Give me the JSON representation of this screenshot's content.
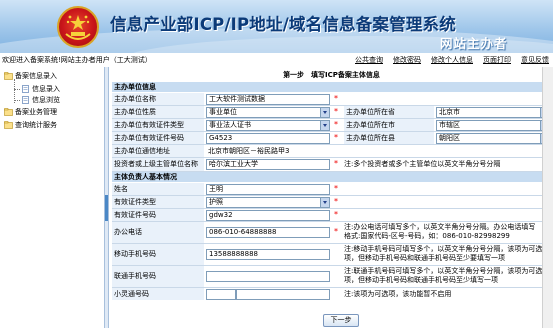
{
  "header": {
    "title": "信息产业部ICP/IP地址/域名信息备案管理系统",
    "subtitle": "网站主办者"
  },
  "userbar": {
    "welcome": "欢迎进入备案系统!网站主办者用户（工大测试）",
    "links": [
      "公共查询",
      "修改密码",
      "修改个人信息",
      "页面打印",
      "意见反馈"
    ]
  },
  "sidebar": {
    "items": [
      {
        "label": "备案信息录入",
        "children": [
          "信息录入",
          "信息浏览"
        ]
      },
      {
        "label": "备案业务管理",
        "children": []
      },
      {
        "label": "查询统计服务",
        "children": []
      }
    ]
  },
  "form": {
    "step_title": "第一步　填写ICP备案主体信息",
    "section1": "主办单位信息",
    "section2": "主体负责人基本情况",
    "org_name_label": "主办单位名称",
    "org_name_value": "工大软件测试数据",
    "org_type_label": "主办单位性质",
    "org_type_value": "事业单位",
    "province_label": "主办单位所在省",
    "province_value": "北京市",
    "cert_type_label": "主办单位有效证件类型",
    "cert_type_value": "事业法人证书",
    "city_label": "主办单位所在市",
    "city_value": "市辖区",
    "cert_no_label": "主办单位有效证件号码",
    "cert_no_value": "G4523",
    "county_label": "主办单位所在县",
    "county_value": "朝阳区",
    "address_label": "主办单位通信地址",
    "address_value": "北京市朝阳区－裕民路甲3",
    "investor_label": "投资者或上级主管单位名称",
    "investor_value": "哈尔滨工业大学",
    "investor_note": "注:多个投资者或多个主管单位以英文半角分号分隔",
    "name_label": "姓名",
    "name_value": "王明",
    "p_cert_type_label": "有效证件类型",
    "p_cert_type_value": "护照",
    "p_cert_no_label": "有效证件号码",
    "p_cert_no_value": "gdw32",
    "office_phone_label": "办公电话",
    "office_phone_value": "086-010-64888888",
    "office_phone_note1": "注:办公电话可填写多个，以英文半角分号分隔。办公电话填写",
    "office_phone_note2": "格式:国家代码-区号-号码，如：086-010-82998299",
    "mobile_label": "移动手机号码",
    "mobile_value": "13588888888",
    "mobile_note1": "注:移动手机号码可填写多个，以英文半角分号分隔，该项为可选",
    "mobile_note2": "项，但移动手机号码和联通手机号码至少要填写一项",
    "unicom_label": "联通手机号码",
    "unicom_value": "",
    "unicom_note1": "注:联通手机号码可填写多个，以英文半角分号分隔，该项为可选",
    "unicom_note2": "项，但移动手机号码和联通手机号码至少填写一项",
    "xlt_label": "小灵通号码",
    "xlt_note": "注:该项为可选项，该功能暂不启用",
    "next_button": "下一步"
  }
}
